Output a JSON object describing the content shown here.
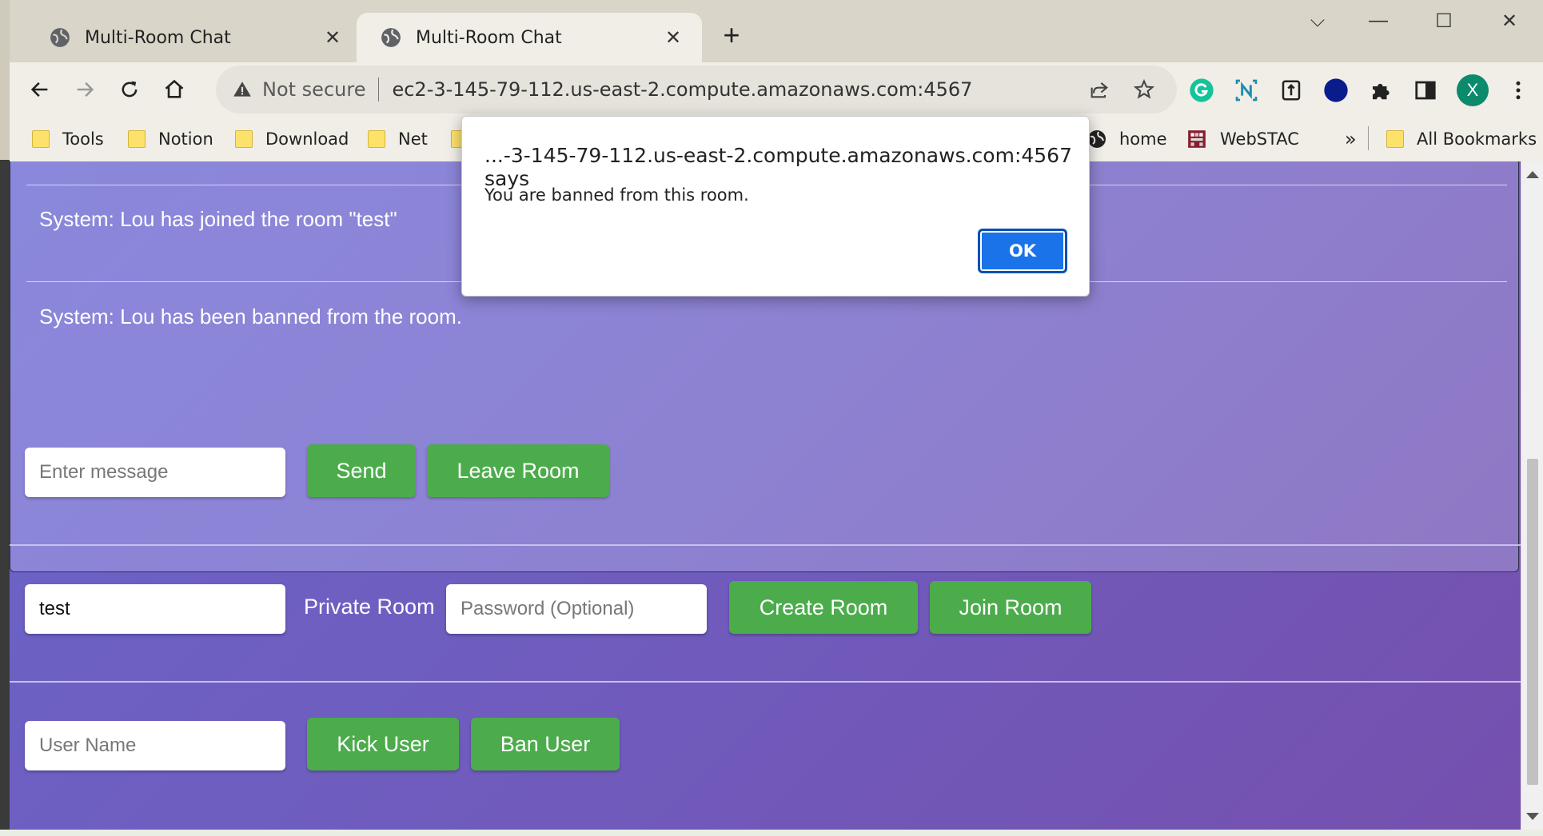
{
  "browser": {
    "tabs": [
      {
        "title": "Multi-Room Chat",
        "close": "✕"
      },
      {
        "title": "Multi-Room Chat",
        "close": "✕"
      }
    ],
    "new_tab": "+",
    "window_controls": {
      "dropdown": "⌵",
      "minimize": "—",
      "maximize": "☐",
      "close": "✕"
    },
    "omnibox": {
      "security": "Not secure",
      "url": "ec2-3-145-79-112.us-east-2.compute.amazonaws.com:4567"
    },
    "profile_initial": "X",
    "bookmarks": [
      {
        "label": "Tools",
        "icon": "folder-icon"
      },
      {
        "label": "Notion",
        "icon": "folder-icon"
      },
      {
        "label": "Download",
        "icon": "folder-icon"
      },
      {
        "label": "Net",
        "icon": "folder-icon"
      },
      {
        "label": "home",
        "icon": "globe-icon"
      },
      {
        "label": "WebSTAC",
        "icon": "webstac-icon"
      }
    ],
    "bookmarks_overflow": "»",
    "all_bookmarks": "All Bookmarks"
  },
  "chat": {
    "messages": [
      "System: Lou has joined the room \"test\"",
      "System: Lou has been banned from the room."
    ]
  },
  "message_form": {
    "placeholder": "Enter message",
    "send_label": "Send",
    "leave_label": "Leave Room"
  },
  "room_form": {
    "room_value": "test",
    "private_label": "Private Room",
    "password_placeholder": "Password (Optional)",
    "create_label": "Create Room",
    "join_label": "Join Room"
  },
  "user_form": {
    "placeholder": "User Name",
    "kick_label": "Kick User",
    "ban_label": "Ban User"
  },
  "dialog": {
    "title": "...-3-145-79-112.us-east-2.compute.amazonaws.com:4567 says",
    "message": "You are banned from this room.",
    "ok_label": "OK"
  },
  "colors": {
    "accent_green": "#4cac4c",
    "dialog_button": "#1a73e8",
    "background_gradient_start": "#6a64c8",
    "background_gradient_end": "#7550ae"
  }
}
